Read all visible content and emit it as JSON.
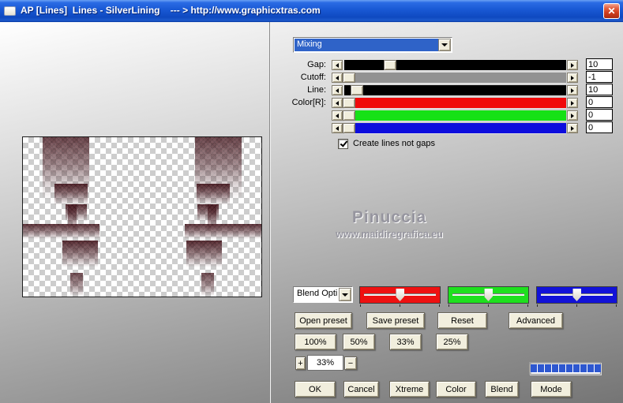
{
  "window": {
    "title": "AP [Lines]  Lines - SilverLining    --- > http://www.graphicxtras.com",
    "close_glyph": "✕"
  },
  "colors": {
    "titlebar_blue": "#1a5ad6",
    "close_red": "#cf3c1d",
    "button_face": "#f1eedd",
    "highlight_blue": "#2f63c8",
    "track_black": "#000000",
    "track_gray": "#929292",
    "track_red": "#f00a0a",
    "track_green": "#16e116",
    "track_blue": "#0d0ddd",
    "blend_red": "#ee1111",
    "blend_green": "#1ee01e",
    "blend_blue": "#1212d8",
    "progress_blue": "#2d57d0"
  },
  "filter_dropdown": {
    "value": "Mixing"
  },
  "sliders": {
    "rows": [
      {
        "label": "Gap:",
        "value": "10"
      },
      {
        "label": "Cutoff:",
        "value": "-1"
      },
      {
        "label": "Line:",
        "value": "10"
      },
      {
        "label": "Color[R]:",
        "value": "0"
      },
      {
        "label": "",
        "value": "0"
      },
      {
        "label": "",
        "value": "0"
      }
    ],
    "checkbox_label": "Create lines not gaps",
    "checkbox_checked": true
  },
  "watermark": {
    "name": "Pinuccia",
    "site": "www.maidiregrafica.eu"
  },
  "blend": {
    "dropdown_value": "Blend Opti"
  },
  "buttons": {
    "presets": [
      "Open preset",
      "Save preset",
      "Reset",
      "Advanced"
    ],
    "zoom_presets": [
      "100%",
      "50%",
      "33%",
      "25%"
    ],
    "actions": [
      "OK",
      "Cancel",
      "Xtreme",
      "Color",
      "Blend",
      "Mode"
    ]
  },
  "zoom_control": {
    "plus": "+",
    "value": "33%",
    "minus": "−"
  },
  "progress": {
    "segments": 10
  }
}
